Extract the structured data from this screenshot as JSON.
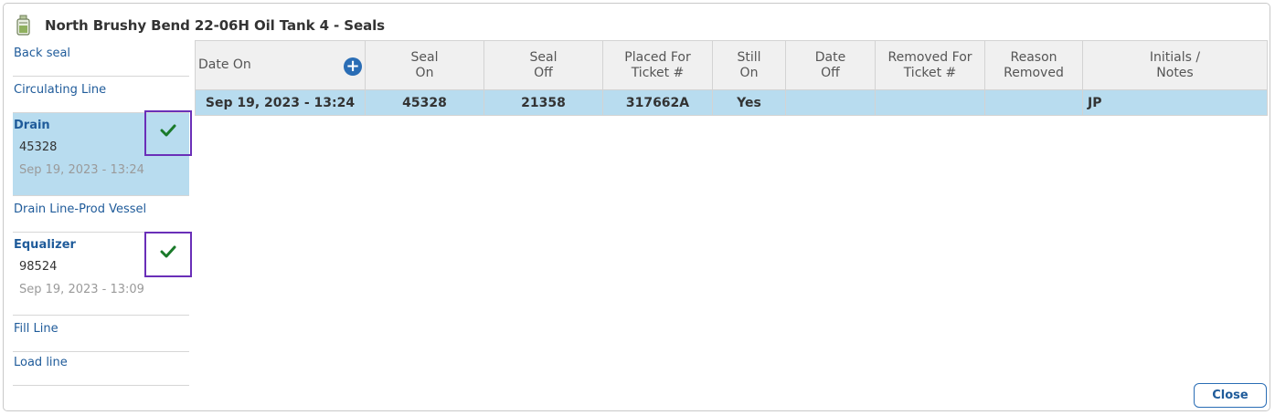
{
  "window": {
    "title": "North Brushy Bend 22-06H Oil Tank 4 - Seals",
    "icon": "oil-tank-icon"
  },
  "sidebar": {
    "items": [
      {
        "label": "Back seal"
      },
      {
        "label": "Circulating Line"
      },
      {
        "label": "Drain",
        "value": "45328",
        "date": "Sep 19, 2023 - 13:24",
        "selected": true,
        "checked": true
      },
      {
        "label": "Drain Line-Prod Vessel"
      },
      {
        "label": "Equalizer",
        "value": "98524",
        "date": "Sep 19, 2023 - 13:09",
        "checked": true
      },
      {
        "label": "Fill Line"
      },
      {
        "label": "Load line"
      }
    ]
  },
  "table": {
    "headers": [
      [
        "Date On"
      ],
      [
        "Seal",
        "On"
      ],
      [
        "Seal",
        "Off"
      ],
      [
        "Placed For",
        "Ticket #"
      ],
      [
        "Still",
        "On"
      ],
      [
        "Date",
        "Off"
      ],
      [
        "Removed For",
        "Ticket #"
      ],
      [
        "Reason",
        "Removed"
      ],
      [
        "Initials /",
        "Notes"
      ]
    ],
    "rows": [
      [
        "Sep 19, 2023 - 13:24",
        "45328",
        "21358",
        "317662A",
        "Yes",
        "",
        "",
        "",
        "JP"
      ]
    ]
  },
  "actions": {
    "close_label": "Close"
  },
  "colors": {
    "accent": "#1f5b9a",
    "selected_bg": "#b8dcef",
    "highlight_box": "#6a2fb8",
    "check": "#1a7a2a"
  }
}
